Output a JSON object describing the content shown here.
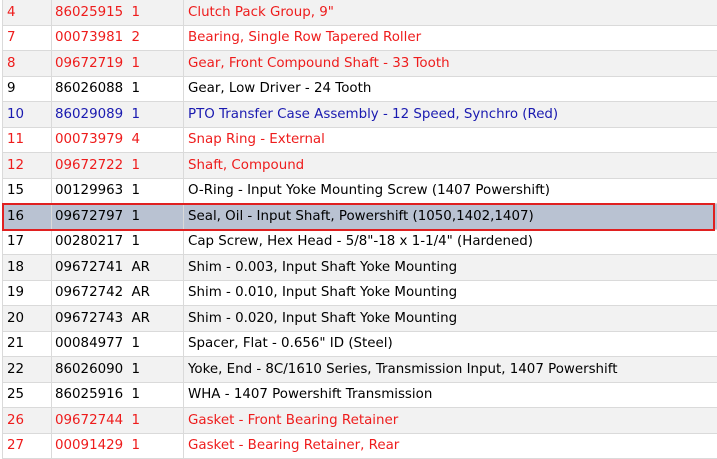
{
  "colors": {
    "highlight_text": "#ee1c1c",
    "link_text": "#1a1ab0",
    "selected_row_bg": "#b9c2d2",
    "selection_border": "#e02020"
  },
  "rows": [
    {
      "item": "4",
      "part": "86025915",
      "qty": "1",
      "desc": "Clutch Pack Group, 9\"",
      "color": "red"
    },
    {
      "item": "7",
      "part": "00073981",
      "qty": "2",
      "desc": "Bearing, Single Row Tapered Roller",
      "color": "red"
    },
    {
      "item": "8",
      "part": "09672719",
      "qty": "1",
      "desc": "Gear, Front Compound Shaft - 33 Tooth",
      "color": "red"
    },
    {
      "item": "9",
      "part": "86026088",
      "qty": "1",
      "desc": "Gear, Low Driver - 24 Tooth",
      "color": "black"
    },
    {
      "item": "10",
      "part": "86029089",
      "qty": "1",
      "desc": "PTO Transfer Case Assembly - 12 Speed, Synchro (Red)",
      "color": "blue"
    },
    {
      "item": "11",
      "part": "00073979",
      "qty": "4",
      "desc": "Snap Ring - External",
      "color": "red"
    },
    {
      "item": "12",
      "part": "09672722",
      "qty": "1",
      "desc": "Shaft, Compound",
      "color": "red"
    },
    {
      "item": "15",
      "part": "00129963",
      "qty": "1",
      "desc": "O-Ring - Input Yoke Mounting Screw (1407 Powershift)",
      "color": "black"
    },
    {
      "item": "16",
      "part": "09672797",
      "qty": "1",
      "desc": "Seal, Oil - Input Shaft, Powershift (1050,1402,1407)",
      "color": "black",
      "selected": true
    },
    {
      "item": "17",
      "part": "00280217",
      "qty": "1",
      "desc": "Cap Screw, Hex Head - 5/8\"-18 x 1-1/4\" (Hardened)",
      "color": "black"
    },
    {
      "item": "18",
      "part": "09672741",
      "qty": "AR",
      "desc": "Shim - 0.003, Input Shaft Yoke Mounting",
      "color": "black"
    },
    {
      "item": "19",
      "part": "09672742",
      "qty": "AR",
      "desc": "Shim - 0.010, Input Shaft Yoke Mounting",
      "color": "black"
    },
    {
      "item": "20",
      "part": "09672743",
      "qty": "AR",
      "desc": "Shim - 0.020, Input Shaft Yoke Mounting",
      "color": "black"
    },
    {
      "item": "21",
      "part": "00084977",
      "qty": "1",
      "desc": "Spacer, Flat - 0.656\" ID (Steel)",
      "color": "black"
    },
    {
      "item": "22",
      "part": "86026090",
      "qty": "1",
      "desc": "Yoke, End - 8C/1610 Series, Transmission Input, 1407 Powershift",
      "color": "black"
    },
    {
      "item": "25",
      "part": "86025916",
      "qty": "1",
      "desc": "WHA - 1407 Powershift Transmission",
      "color": "black"
    },
    {
      "item": "26",
      "part": "09672744",
      "qty": "1",
      "desc": "Gasket - Front Bearing Retainer",
      "color": "red"
    },
    {
      "item": "27",
      "part": "00091429",
      "qty": "1",
      "desc": "Gasket - Bearing Retainer, Rear",
      "color": "red"
    }
  ]
}
